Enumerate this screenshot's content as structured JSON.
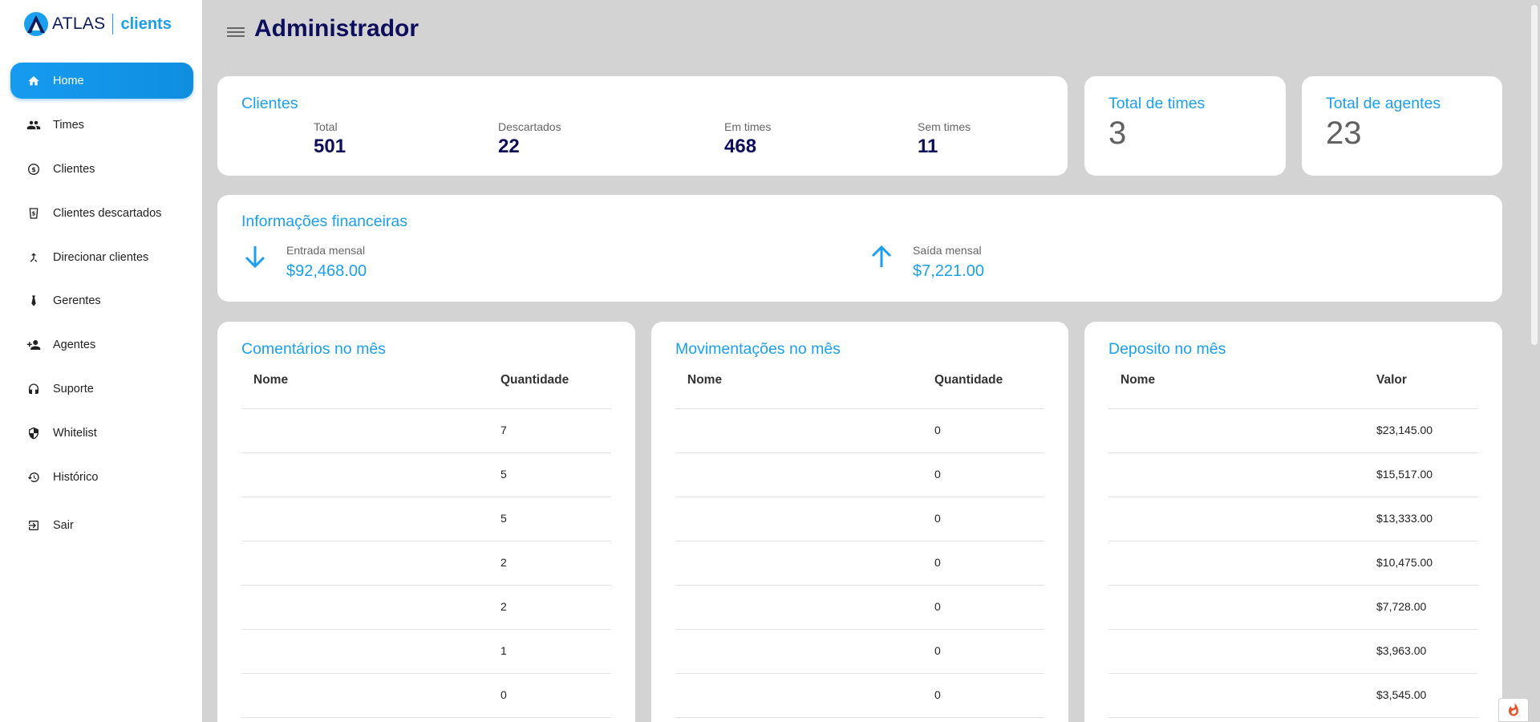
{
  "brand": {
    "name": "ATLAS",
    "product": "clients"
  },
  "sidebar": {
    "items": [
      {
        "label": "Home",
        "icon": "home-icon"
      },
      {
        "label": "Times",
        "icon": "group-icon"
      },
      {
        "label": "Clientes",
        "icon": "dollar-coin-icon"
      },
      {
        "label": "Clientes descartados",
        "icon": "discard-bin-icon"
      },
      {
        "label": "Direcionar clientes",
        "icon": "merge-arrows-icon"
      },
      {
        "label": "Gerentes",
        "icon": "tie-icon"
      },
      {
        "label": "Agentes",
        "icon": "person-add-icon"
      },
      {
        "label": "Suporte",
        "icon": "headset-icon"
      },
      {
        "label": "Whitelist",
        "icon": "shield-icon"
      },
      {
        "label": "Histórico",
        "icon": "history-icon"
      },
      {
        "label": "Sair",
        "icon": "logout-icon"
      }
    ],
    "active_index": 0
  },
  "header": {
    "title": "Administrador"
  },
  "clientes_card": {
    "title": "Clientes",
    "stats": [
      {
        "label": "Total",
        "value": "501"
      },
      {
        "label": "Descartados",
        "value": "22"
      },
      {
        "label": "Em times",
        "value": "468"
      },
      {
        "label": "Sem times",
        "value": "11"
      }
    ]
  },
  "times_card": {
    "title": "Total de times",
    "value": "3"
  },
  "agentes_card": {
    "title": "Total de agentes",
    "value": "23"
  },
  "finance_card": {
    "title": "Informações financeiras",
    "entrada": {
      "label": "Entrada mensal",
      "value": "$92,468.00"
    },
    "saida": {
      "label": "Saída mensal",
      "value": "$7,221.00"
    }
  },
  "comentarios": {
    "title": "Comentários no mês",
    "columns": [
      "Nome",
      "Quantidade"
    ],
    "rows": [
      "7",
      "5",
      "5",
      "2",
      "2",
      "1",
      "0"
    ]
  },
  "movimentacoes": {
    "title": "Movimentações no mês",
    "columns": [
      "Nome",
      "Quantidade"
    ],
    "rows": [
      "0",
      "0",
      "0",
      "0",
      "0",
      "0",
      "0"
    ]
  },
  "deposito": {
    "title": "Deposito no mês",
    "columns": [
      "Nome",
      "Valor"
    ],
    "rows": [
      "$23,145.00",
      "$15,517.00",
      "$13,333.00",
      "$10,475.00",
      "$7,728.00",
      "$3,963.00",
      "$3,545.00"
    ]
  },
  "colors": {
    "accent": "#1aa0ee",
    "navy": "#0d0e5c",
    "background": "#d3d3d3"
  }
}
